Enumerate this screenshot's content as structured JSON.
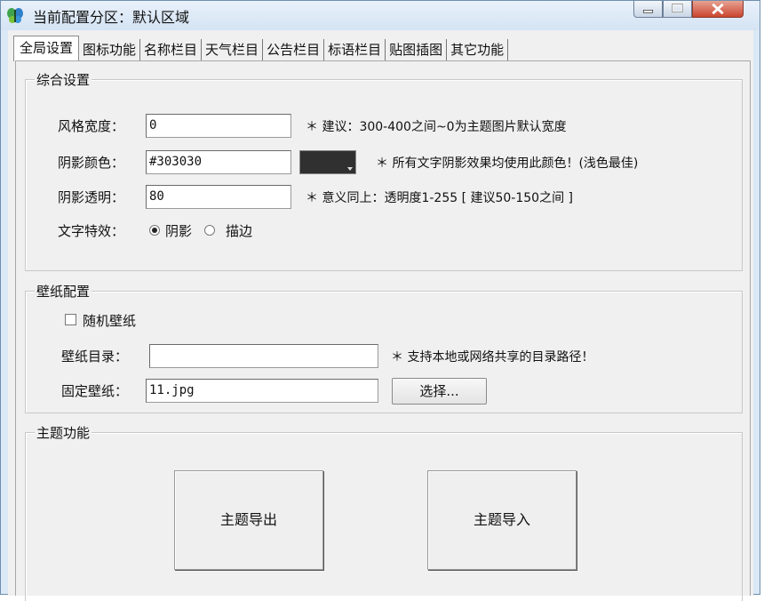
{
  "window": {
    "title": "当前配置分区：默认区域",
    "icon": "app-butterfly-icon",
    "controls": {
      "minimize": "minimize-icon",
      "maximize": "maximize-icon",
      "close": "close-icon"
    }
  },
  "tabs": [
    {
      "label": "全局设置",
      "active": true
    },
    {
      "label": "图标功能"
    },
    {
      "label": "名称栏目"
    },
    {
      "label": "天气栏目"
    },
    {
      "label": "公告栏目"
    },
    {
      "label": "标语栏目"
    },
    {
      "label": "贴图插图"
    },
    {
      "label": "其它功能"
    }
  ],
  "general": {
    "title": "综合设置",
    "style_width": {
      "label": "风格宽度：",
      "value": "0",
      "hint": "＊ 建议：300-400之间~0为主题图片默认宽度"
    },
    "shadow_color": {
      "label": "阴影颜色：",
      "value": "#303030",
      "swatch": "#303030",
      "hint": "＊ 所有文字阴影效果均使用此颜色！(浅色最佳)"
    },
    "shadow_alpha": {
      "label": "阴影透明：",
      "value": "80",
      "hint": "＊ 意义同上：透明度1-255 [ 建议50-150之间 ]"
    },
    "text_effect": {
      "label": "文字特效：",
      "options": [
        "阴影",
        "描边"
      ],
      "selected": "阴影"
    }
  },
  "wallpaper": {
    "title": "壁纸配置",
    "random": {
      "label": "随机壁纸",
      "checked": false
    },
    "dir": {
      "label": "壁纸目录：",
      "value": "",
      "hint": "＊ 支持本地或网络共享的目录路径！"
    },
    "fixed": {
      "label": "固定壁纸：",
      "value": "11.jpg",
      "button": "选择..."
    }
  },
  "theme": {
    "title": "主题功能",
    "export_label": "主题导出",
    "import_label": "主题导入"
  }
}
